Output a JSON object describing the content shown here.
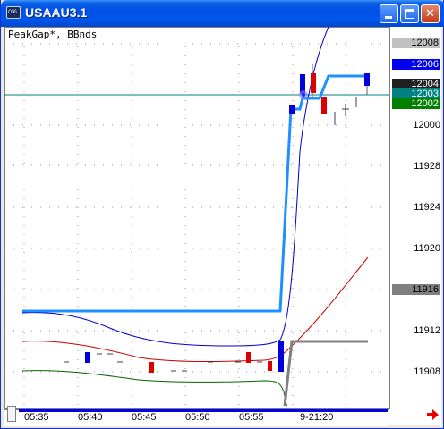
{
  "window": {
    "title": "USAAU3.1",
    "icon_label": "CQG",
    "minimize_icon": "minimize-icon",
    "maximize_icon": "maximize-icon",
    "close_icon": "close-icon"
  },
  "chart": {
    "indicator_label": "PeakGap*, BBnds",
    "background": "#ffffff",
    "price_axis": {
      "labels": [
        "12008",
        "12006",
        "12004",
        "12003",
        "12002",
        "12000",
        "11928",
        "11924",
        "11920",
        "11916",
        "11912",
        "11908"
      ],
      "highlight_boxes": [
        {
          "label": "12008",
          "bg": "#c0c0c0",
          "fg": "#000000"
        },
        {
          "label": "12006",
          "bg": "#0000ee",
          "fg": "#ffffff"
        },
        {
          "label": "12004",
          "bg": "#202020",
          "fg": "#ffffff"
        },
        {
          "label": "12003",
          "bg": "#008080",
          "fg": "#ffffff"
        },
        {
          "label": "12002",
          "bg": "#008000",
          "fg": "#ffffff"
        },
        {
          "label": "11916",
          "bg": "#808080",
          "fg": "#000000"
        }
      ]
    },
    "time_axis": {
      "labels": [
        "05:35",
        "05:40",
        "05:45",
        "05:50",
        "05:55",
        "9-21:20"
      ]
    },
    "colors": {
      "upper_band": "#0000cc",
      "middle_band": "#cc0000",
      "lower_band": "#006600",
      "peak_line": "#1e90ff",
      "gray_line": "#808080",
      "horizontal_ref": "#008080",
      "bull_bar": "#0000dd",
      "bear_bar": "#dd0000"
    }
  }
}
